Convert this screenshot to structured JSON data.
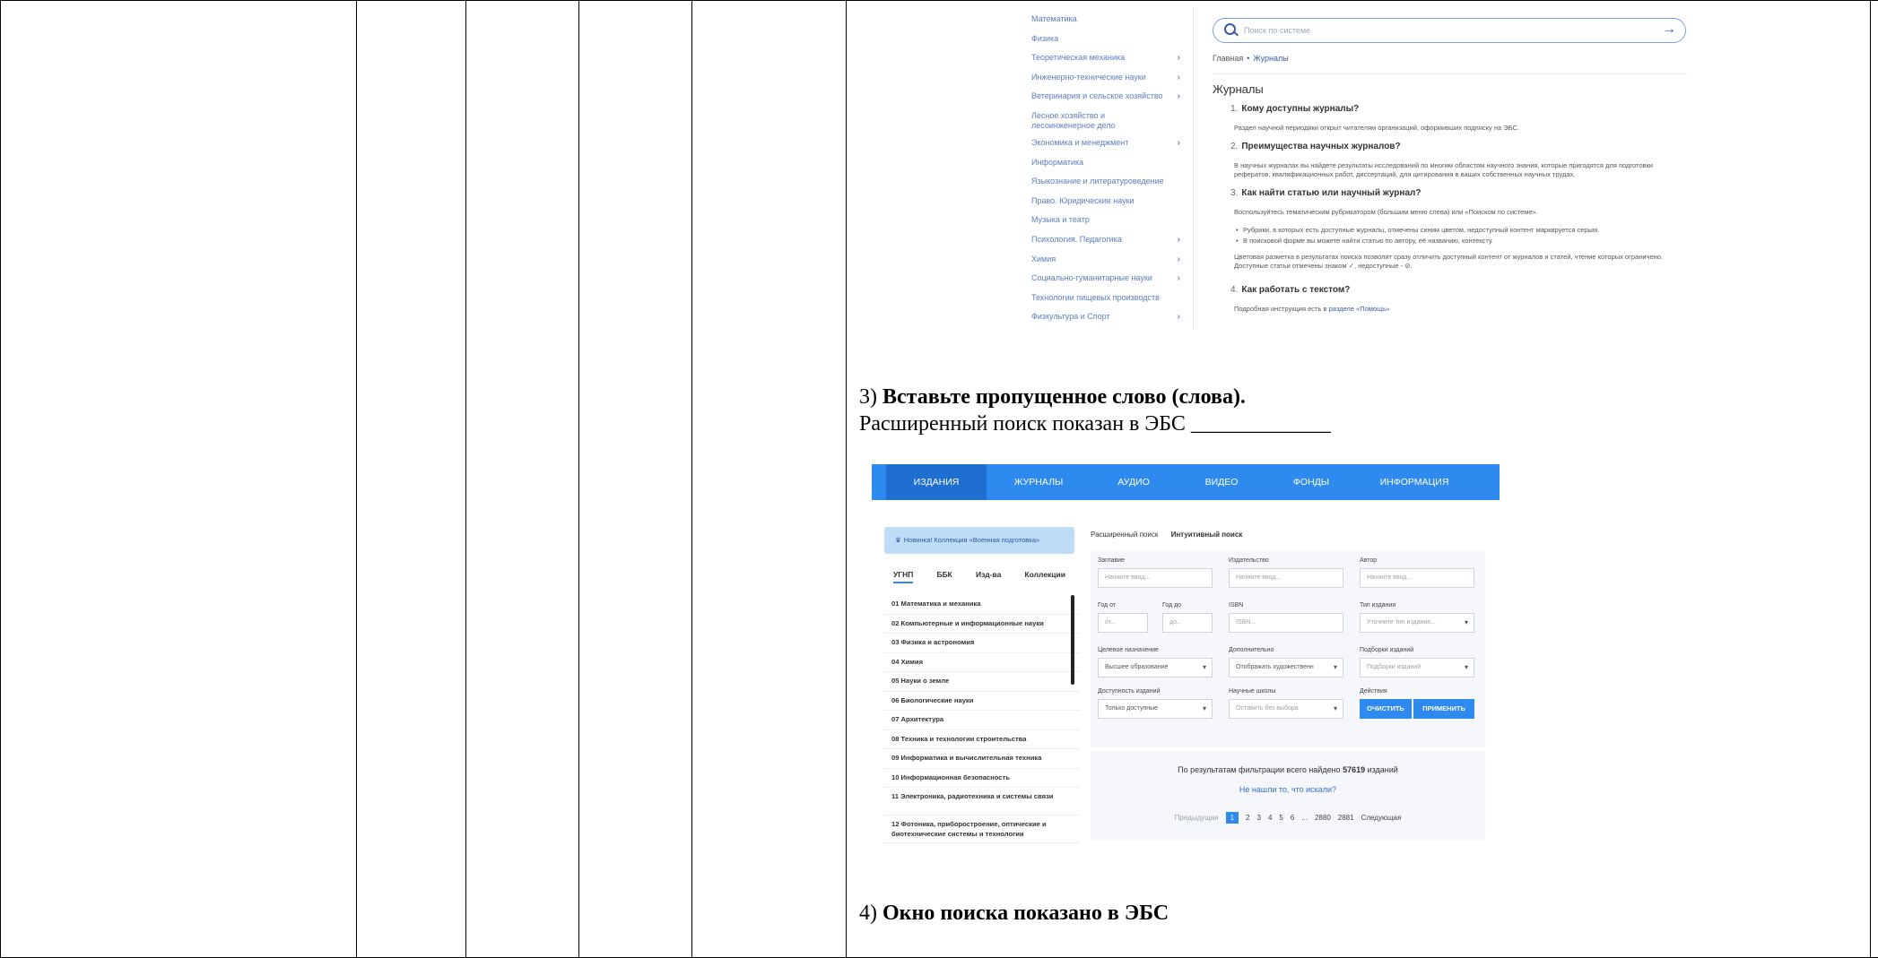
{
  "screenshot1": {
    "categories": [
      {
        "label": "Математика",
        "has_arrow": false
      },
      {
        "label": "Физика",
        "has_arrow": false
      },
      {
        "label": "Теоретическая механика",
        "has_arrow": true
      },
      {
        "label": "Инженерно-технические науки",
        "has_arrow": true
      },
      {
        "label": "Ветеринария и сельское хозяйство",
        "has_arrow": true
      },
      {
        "label": "Лесное хозяйство и лесоинженерное дело",
        "has_arrow": false
      },
      {
        "label": "Экономика и менеджмент",
        "has_arrow": true
      },
      {
        "label": "Информатика",
        "has_arrow": false
      },
      {
        "label": "Языкознание и литературоведение",
        "has_arrow": false
      },
      {
        "label": "Право. Юридические науки",
        "has_arrow": false
      },
      {
        "label": "Музыка и театр",
        "has_arrow": false
      },
      {
        "label": "Психология. Педагогика",
        "has_arrow": true
      },
      {
        "label": "Химия",
        "has_arrow": true
      },
      {
        "label": "Социально-гуманитарные науки",
        "has_arrow": true
      },
      {
        "label": "Технологии пищевых производств",
        "has_arrow": false
      },
      {
        "label": "Физкультура и Спорт",
        "has_arrow": true
      }
    ],
    "search_placeholder": "Поиск по системе",
    "breadcrumb_home": "Главная",
    "breadcrumb_current": "Журналы",
    "heading": "Журналы",
    "q1": {
      "num": "1.",
      "title": "Кому доступны журналы?",
      "text": "Раздел научной периодики открыт читателям организаций, оформивших подписку на ЭБС."
    },
    "q2": {
      "num": "2.",
      "title": "Преимущества научных журналов?",
      "text": "В научных журналах вы найдете результаты исследований по многим областям научного знания, которые пригодятся для подготовки рефератов, квалификационных работ, диссертаций, для цитирования в ваших собственных научных трудах."
    },
    "q3": {
      "num": "3.",
      "title": "Как найти статью или научный журнал?",
      "text": "Воспользуйтесь тематическим рубрикатором (большим меню слева) или «Поиском по системе».",
      "bullet1": "Рубрики, в которых есть доступные журналы, отмечены синим цветом, недоступный контент маркируется серым.",
      "bullet2": "В поисковой форме вы можете найти статью по автору, её названию, контексту.",
      "text2": "Цветовая разметка в результатах поиска позволит сразу отличить доступный контент от журналов и статей, чтение которых ограничено. Доступные статьи отмечены знаком ✓, недоступные - ⊘."
    },
    "q4": {
      "num": "4.",
      "title": "Как работать с текстом?",
      "text_prefix": "Подробная инструкция есть в ",
      "text_link": "разделе «Помощь»"
    }
  },
  "question3": {
    "number": "3)",
    "title": "Вставьте пропущенное слово (слова).",
    "line": "Расширенный поиск показан в ЭБС _____________"
  },
  "screenshot2": {
    "nav": [
      "ИЗДАНИЯ",
      "ЖУРНАЛЫ",
      "АУДИО",
      "ВИДЕО",
      "ФОНДЫ",
      "ИНФОРМАЦИЯ"
    ],
    "notice": "Новинка! Коллекция «Военная подготовка»",
    "left_tabs": [
      "УГНП",
      "ББК",
      "Изд-ва",
      "Коллекции"
    ],
    "list": [
      "01 Математика и механика",
      "02 Компьютерные и информационные науки",
      "03 Физика и астрономия",
      "04 Химия",
      "05 Науки о земле",
      "06 Биологические науки",
      "07 Архитектура",
      "08 Техника и технологии строительства",
      "09 Информатика и вычислительная техника",
      "10 Информационная безопасность",
      "11 Электроника, радиотехника и системы связи",
      "12 Фотоника, приборостроение, оптические и биотехнические системы и технологии"
    ],
    "right_tabs": [
      "Расширенный поиск",
      "Интуитивный поиск"
    ],
    "fields": {
      "title_label": "Заглавие",
      "title_ph": "Начните ввод...",
      "publisher_label": "Издательство",
      "publisher_ph": "Начните ввод...",
      "author_label": "Автор",
      "author_ph": "Начните ввод...",
      "year_from_label": "Год от",
      "year_from_ph": "от...",
      "year_to_label": "Год до",
      "year_to_ph": "до...",
      "isbn_label": "ISBN",
      "isbn_ph": "ISBN...",
      "type_label": "Тип издания",
      "type_ph": "Уточните тип издания...",
      "purpose_label": "Целевое назначение",
      "purpose_val": "Высшее образование",
      "extra_label": "Дополнительно",
      "extra_val": "Отображать художественн",
      "collections_label": "Подборки изданий",
      "collections_ph": "Подборки изданий",
      "availability_label": "Доступность изданий",
      "availability_val": "Только доступные",
      "schools_label": "Научные школы",
      "schools_ph": "Оставить без выбора",
      "actions_label": "Действия",
      "clear_btn": "ОЧИСТИТЬ",
      "apply_btn": "ПРИМЕНИТЬ"
    },
    "found_prefix": "По результатам фильтрации всего найдено ",
    "found_count": "57619",
    "found_suffix": " изданий",
    "not_found": "Не нашли то, что искали?",
    "pager": {
      "prev": "Предыдущая",
      "pages": [
        "1",
        "2",
        "3",
        "4",
        "5",
        "6",
        "...",
        "2880",
        "2881"
      ],
      "next": "Следующая"
    }
  },
  "question4": {
    "number": "4)",
    "title": "Окно поиска показано в ЭБС"
  }
}
